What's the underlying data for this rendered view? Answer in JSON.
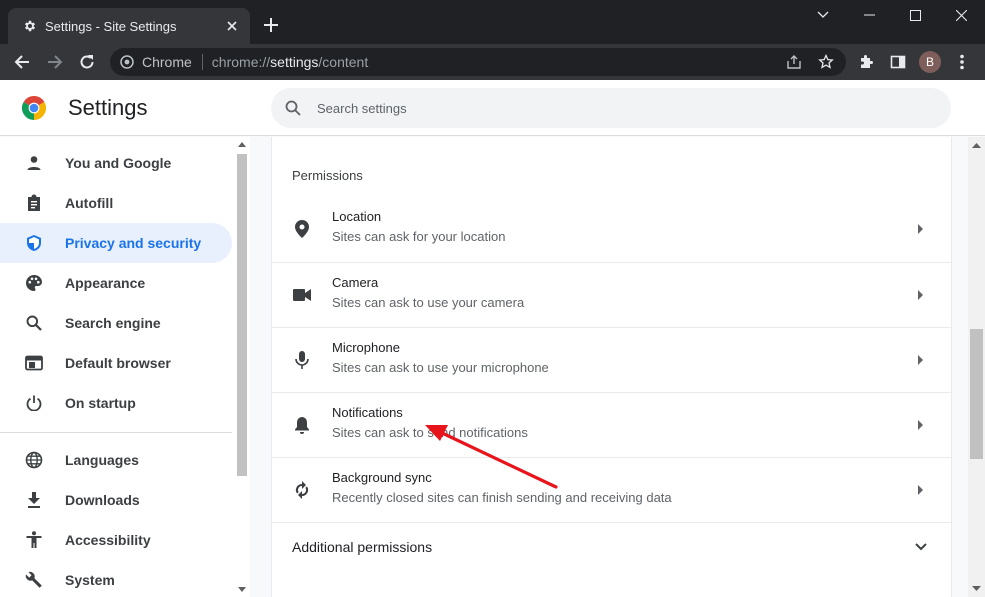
{
  "browser": {
    "tab_title": "Settings - Site Settings",
    "omnibox_site": "Chrome",
    "url_prefix": "chrome://",
    "url_bold": "settings",
    "url_suffix": "/content",
    "profile_initial": "B"
  },
  "app": {
    "title": "Settings",
    "search_placeholder": "Search settings"
  },
  "sidebar": {
    "items": [
      {
        "label": "You and Google",
        "icon": "person-icon"
      },
      {
        "label": "Autofill",
        "icon": "clipboard-icon"
      },
      {
        "label": "Privacy and security",
        "icon": "shield-icon",
        "active": true
      },
      {
        "label": "Appearance",
        "icon": "palette-icon"
      },
      {
        "label": "Search engine",
        "icon": "search-icon"
      },
      {
        "label": "Default browser",
        "icon": "browser-window-icon"
      },
      {
        "label": "On startup",
        "icon": "power-icon"
      },
      {
        "label": "Languages",
        "icon": "globe-icon"
      },
      {
        "label": "Downloads",
        "icon": "download-icon"
      },
      {
        "label": "Accessibility",
        "icon": "accessibility-icon"
      },
      {
        "label": "System",
        "icon": "wrench-icon"
      }
    ]
  },
  "permissions": {
    "heading": "Permissions",
    "items": [
      {
        "title": "Location",
        "subtitle": "Sites can ask for your location",
        "icon": "location-pin-icon"
      },
      {
        "title": "Camera",
        "subtitle": "Sites can ask to use your camera",
        "icon": "camera-icon"
      },
      {
        "title": "Microphone",
        "subtitle": "Sites can ask to use your microphone",
        "icon": "microphone-icon"
      },
      {
        "title": "Notifications",
        "subtitle": "Sites can ask to send notifications",
        "icon": "bell-icon"
      },
      {
        "title": "Background sync",
        "subtitle": "Recently closed sites can finish sending and receiving data",
        "icon": "sync-icon"
      }
    ],
    "additional_label": "Additional permissions"
  },
  "colors": {
    "accent": "#1a73e8",
    "active_bg": "#e8f0fe",
    "annotation_arrow": "#e8141c"
  }
}
